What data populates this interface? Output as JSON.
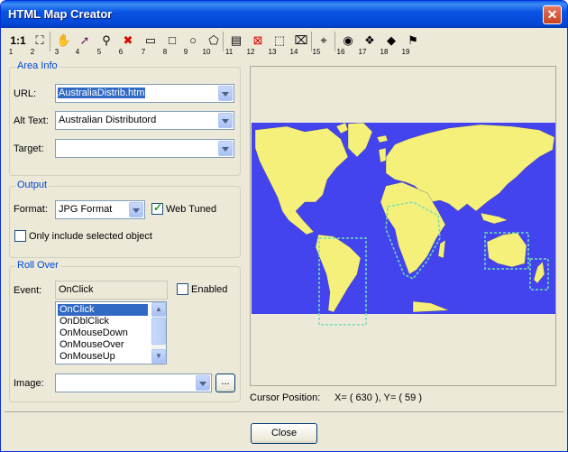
{
  "window": {
    "title": "HTML Map Creator"
  },
  "toolbar": {
    "buttons": [
      {
        "num": "1",
        "icon": "actual-size-icon",
        "glyph": "1:1"
      },
      {
        "num": "2",
        "icon": "fit-to-window-icon",
        "glyph": "⛶"
      },
      {
        "num": "3",
        "icon": "hand-pan-icon",
        "glyph": "✋"
      },
      {
        "num": "4",
        "icon": "select-arrow-icon",
        "glyph": "➚"
      },
      {
        "num": "5",
        "icon": "pipette-icon",
        "glyph": "⚲"
      },
      {
        "num": "6",
        "icon": "delete-icon",
        "glyph": "✖"
      },
      {
        "num": "7",
        "icon": "rectangle-icon",
        "glyph": "▭"
      },
      {
        "num": "8",
        "icon": "square-icon",
        "glyph": "□"
      },
      {
        "num": "9",
        "icon": "circle-icon",
        "glyph": "○"
      },
      {
        "num": "10",
        "icon": "polygon-icon",
        "glyph": "⬠"
      },
      {
        "num": "11",
        "icon": "new-area-icon",
        "glyph": "▤"
      },
      {
        "num": "12",
        "icon": "delete-area-icon",
        "glyph": "⊠"
      },
      {
        "num": "13",
        "icon": "dashed-select-icon",
        "glyph": "⬚"
      },
      {
        "num": "14",
        "icon": "remove-selection-icon",
        "glyph": "⌧"
      },
      {
        "num": "15",
        "icon": "pointer-grid-icon",
        "glyph": "⌖"
      },
      {
        "num": "16",
        "icon": "preview-eye-icon",
        "glyph": "◉"
      },
      {
        "num": "17",
        "icon": "shapes-icon",
        "glyph": "❖"
      },
      {
        "num": "18",
        "icon": "save-map-icon",
        "glyph": "◆"
      },
      {
        "num": "19",
        "icon": "export-icon",
        "glyph": "⚑"
      }
    ]
  },
  "area_info": {
    "legend": "Area Info",
    "url_label": "URL:",
    "url_value": "AustraliaDistrib.htm",
    "alt_label": "Alt Text:",
    "alt_value": "Australian Distributord",
    "target_label": "Target:",
    "target_value": ""
  },
  "output": {
    "legend": "Output",
    "format_label": "Format:",
    "format_value": "JPG Format",
    "web_tuned_label": "Web Tuned",
    "web_tuned_checked": true,
    "selected_only_label": "Only include selected object",
    "selected_only_checked": false
  },
  "rollover": {
    "legend": "Roll Over",
    "event_label": "Event:",
    "event_value": "OnClick",
    "enabled_label": "Enabled",
    "enabled_checked": false,
    "events": [
      "OnClick",
      "OnDblClick",
      "OnMouseDown",
      "OnMouseOver",
      "OnMouseUp"
    ],
    "image_label": "Image:",
    "image_value": "",
    "browse_label": "..."
  },
  "status": {
    "cursor_label": "Cursor Position:",
    "cursor_value": "X= ( 630 ), Y= ( 59 )"
  },
  "footer": {
    "close_label": "Close"
  },
  "colors": {
    "ocean": "#4444ee",
    "land": "#f5f07a",
    "selection": "#6ee0b4"
  }
}
